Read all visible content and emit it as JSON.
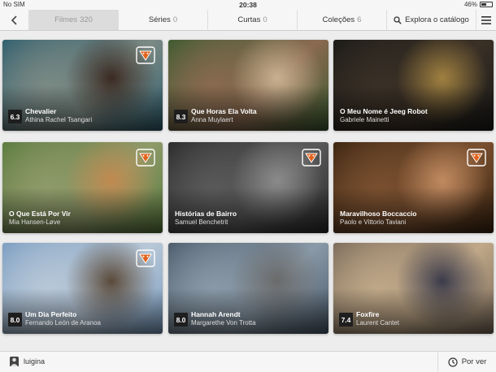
{
  "status_bar": {
    "carrier": "No SIM",
    "time": "20:38",
    "battery": "46%",
    "battery_level": 0.46
  },
  "nav": {
    "tabs": [
      {
        "label": "Filmes",
        "count": "320"
      },
      {
        "label": "Séries",
        "count": "0"
      },
      {
        "label": "Curtas",
        "count": "0"
      },
      {
        "label": "Coleções",
        "count": "6"
      }
    ],
    "explore_label": "Explora o catálogo"
  },
  "cards": [
    {
      "score": "6.3",
      "title": "Chevalier",
      "subtitle": "Athina Rachel Tsangari",
      "badge": true,
      "colors": [
        "#2e5e6e",
        "#7c8a84",
        "#3a2a22"
      ]
    },
    {
      "score": "8.3",
      "title": "Que Horas Ela Volta",
      "subtitle": "Anna Muylaert",
      "badge": false,
      "colors": [
        "#3b5b30",
        "#8a6a50",
        "#c8b090"
      ]
    },
    {
      "score": "",
      "title": "O Meu Nome é Jeeg Robot",
      "subtitle": "Gabriele Mainetti",
      "badge": false,
      "colors": [
        "#1a1a18",
        "#3a3026",
        "#a08040"
      ]
    },
    {
      "score": "",
      "title": "O Que Está Por Vir",
      "subtitle": "Mia  Hansen-Løve",
      "badge": true,
      "colors": [
        "#5a7a3e",
        "#8f9a6a",
        "#c08a50"
      ]
    },
    {
      "score": "",
      "title": "Histórias de Bairro",
      "subtitle": "Samuel Benchetrit",
      "badge": true,
      "colors": [
        "#2a2a2a",
        "#5a5a5a",
        "#8a8a8a"
      ]
    },
    {
      "score": "",
      "title": "Maravilhoso Boccaccio",
      "subtitle": "Paolo e Vittorio Taviani",
      "badge": true,
      "colors": [
        "#3a2410",
        "#7a5030",
        "#c08a60"
      ]
    },
    {
      "score": "8.0",
      "title": "Um Dia Perfeito",
      "subtitle": "Fernando León de Aranoa",
      "badge": true,
      "colors": [
        "#7a9cc0",
        "#b8c8d8",
        "#5a4a3a"
      ]
    },
    {
      "score": "8.0",
      "title": "Hannah Arendt",
      "subtitle": "Margarethe Von Trotta",
      "badge": false,
      "colors": [
        "#4a5a6a",
        "#8a9aa8",
        "#6a6a6a"
      ]
    },
    {
      "score": "7.4",
      "title": "Foxfire",
      "subtitle": "Laurent Cantet",
      "badge": false,
      "colors": [
        "#7a6a5a",
        "#c0a888",
        "#3a3a4a"
      ]
    }
  ],
  "footer": {
    "username": "luigina",
    "watchlist_label": "Por ver"
  },
  "accent_color": "#e2621b"
}
